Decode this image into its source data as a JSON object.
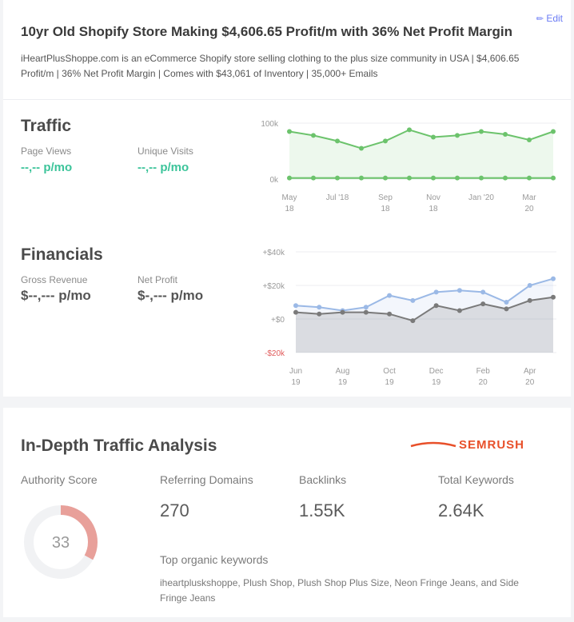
{
  "listing": {
    "edit_label": "Edit",
    "title": "10yr Old Shopify Store Making $4,606.65 Profit/m with 36% Net Profit Margin",
    "description": "iHeartPlusShoppe.com is an eCommerce Shopify store selling clothing to the plus size community in USA | $4,606.65 Profit/m | 36% Net Profit Margin | Comes with $43,061 of Inventory | 35,000+ Emails"
  },
  "traffic": {
    "title": "Traffic",
    "page_views_label": "Page Views",
    "page_views_value": "--,-- p/mo",
    "unique_visits_label": "Unique Visits",
    "unique_visits_value": "--,-- p/mo"
  },
  "financials": {
    "title": "Financials",
    "gross_revenue_label": "Gross Revenue",
    "gross_revenue_value": "$--,--- p/mo",
    "net_profit_label": "Net Profit",
    "net_profit_value": "$-,--- p/mo"
  },
  "analysis": {
    "title": "In-Depth Traffic Analysis",
    "brand_text": "SEMRUSH",
    "authority_label": "Authority Score",
    "authority_value": "33",
    "authority_score": 33,
    "referring_label": "Referring Domains",
    "referring_value": "270",
    "backlinks_label": "Backlinks",
    "backlinks_value": "1.55K",
    "keywords_label": "Total Keywords",
    "keywords_value": "2.64K",
    "organic_label": "Top organic keywords",
    "organic_text": "iheartpluskshoppe, Plush Shop, Plush Shop Plus Size, Neon Fringe Jeans, and Side Fringe Jeans"
  },
  "colors": {
    "traffic_line": "#6cc36c",
    "revenue_line": "#9bb9e6",
    "profit_line": "#7a7a7a",
    "negative_tick": "#e05a5a",
    "brand": "#e8502a",
    "donut": "#e8a09a"
  },
  "chart_data": [
    {
      "type": "area",
      "title": "",
      "xlabel": "",
      "ylabel": "",
      "y_ticks": [
        "100k",
        "0k"
      ],
      "ylim": [
        0,
        100000
      ],
      "categories": [
        "May 18",
        "Jun 18",
        "Jul 18",
        "Aug 18",
        "Sep 18",
        "Oct 18",
        "Nov 18",
        "Dec 18",
        "Jan 19",
        "Feb 19",
        "Mar 19",
        "Apr 19"
      ],
      "x_tick_labels": [
        {
          "index": 0,
          "line1": "May",
          "line2": "18"
        },
        {
          "index": 2,
          "line1": "Jul '18",
          "line2": ""
        },
        {
          "index": 4,
          "line1": "Sep",
          "line2": "18"
        },
        {
          "index": 6,
          "line1": "Nov",
          "line2": "18"
        },
        {
          "index": 8,
          "line1": "Jan '20",
          "line2": ""
        },
        {
          "index": 10,
          "line1": "Mar",
          "line2": "20"
        }
      ],
      "series": [
        {
          "values": [
            85000,
            78000,
            68000,
            55000,
            68000,
            88000,
            75000,
            78000,
            85000,
            80000,
            70000,
            85000
          ]
        },
        {
          "values": [
            2000,
            2000,
            2000,
            2000,
            2000,
            2000,
            2000,
            2000,
            2000,
            2000,
            2000,
            2000
          ]
        }
      ],
      "grid": true
    },
    {
      "type": "line",
      "title": "",
      "xlabel": "",
      "ylabel": "",
      "y_ticks": [
        "+$40k",
        "+$20k",
        "+$0",
        "-$20k"
      ],
      "ylim": [
        -20000,
        40000
      ],
      "categories": [
        "Jun 19",
        "Jul 19",
        "Aug 19",
        "Sep 19",
        "Oct 19",
        "Nov 19",
        "Dec 19",
        "Jan 20",
        "Feb 20",
        "Mar 20",
        "Apr 20",
        "May 20"
      ],
      "x_tick_labels": [
        {
          "index": 0,
          "line1": "Jun",
          "line2": "19"
        },
        {
          "index": 2,
          "line1": "Aug",
          "line2": "19"
        },
        {
          "index": 4,
          "line1": "Oct",
          "line2": "19"
        },
        {
          "index": 6,
          "line1": "Dec",
          "line2": "19"
        },
        {
          "index": 8,
          "line1": "Feb",
          "line2": "20"
        },
        {
          "index": 10,
          "line1": "Apr",
          "line2": "20"
        }
      ],
      "series": [
        {
          "values": [
            8000,
            7000,
            5000,
            7000,
            14000,
            11000,
            16000,
            17000,
            16000,
            10000,
            20000,
            24000
          ]
        },
        {
          "values": [
            4000,
            3000,
            4000,
            4000,
            3000,
            -1000,
            8000,
            5000,
            9000,
            6000,
            11000,
            13000
          ]
        }
      ],
      "grid": true
    }
  ]
}
